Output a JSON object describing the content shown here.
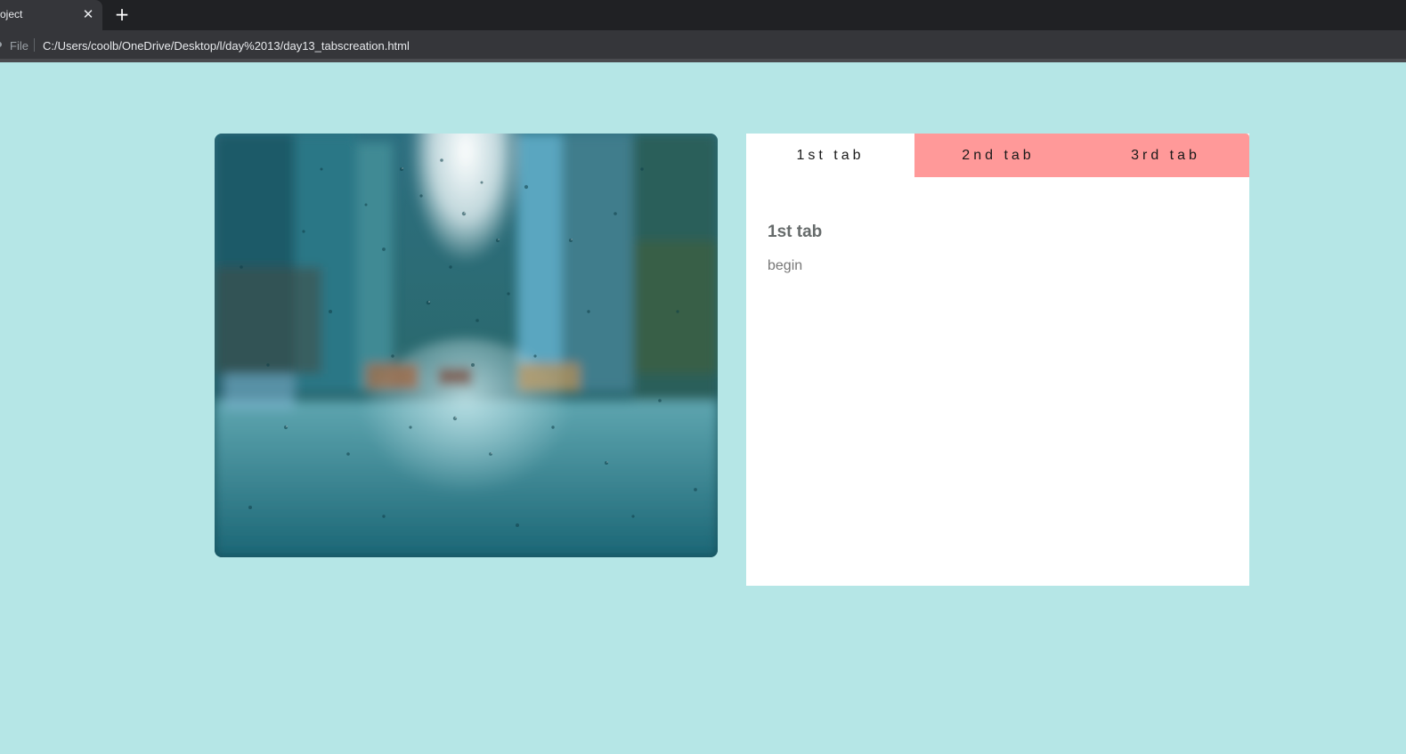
{
  "browser": {
    "tab_title": "oject",
    "close_glyph": "✕",
    "new_tab_glyph": "+",
    "file_label": "File",
    "url": "C:/Users/coolb/OneDrive/Desktop/l/day%2013/day13_tabscreation.html"
  },
  "page": {
    "background_color": "#b5e6e6",
    "image_description_icon": "rainy-street-photo",
    "tabs": [
      {
        "label": "1st tab",
        "active": true
      },
      {
        "label": "2nd tab",
        "active": false
      },
      {
        "label": "3rd tab",
        "active": false
      }
    ],
    "tab_accent_color": "#ff9999",
    "active_panel": {
      "title": "1st tab",
      "text": "begin"
    }
  }
}
